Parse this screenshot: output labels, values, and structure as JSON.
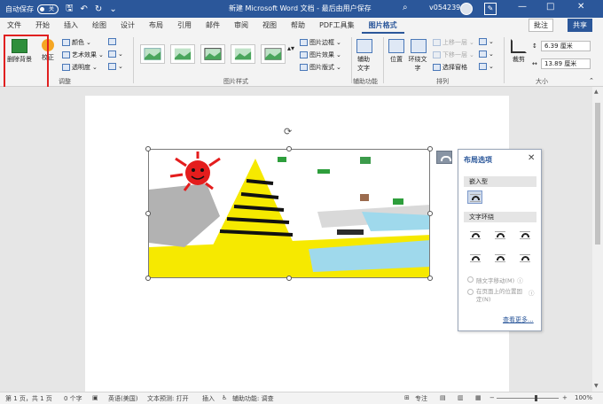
{
  "titlebar": {
    "autosave_label": "自动保存",
    "autosave_state": "关",
    "doc_title": "新建 Microsoft Word 文档  -  最后由用户保存",
    "user_id": "v054239"
  },
  "tabs": [
    "文件",
    "开始",
    "插入",
    "绘图",
    "设计",
    "布局",
    "引用",
    "邮件",
    "审阅",
    "视图",
    "帮助",
    "PDF工具集",
    "图片格式"
  ],
  "active_tab": "图片格式",
  "actions": {
    "comment": "批注",
    "share": "共享"
  },
  "ribbon": {
    "adjust": {
      "remove_bg": "删除背景",
      "correct": "校正",
      "color": "颜色",
      "artistic": "艺术效果",
      "transparency": "透明度",
      "group": "调整"
    },
    "styles": {
      "border": "图片边框",
      "effects": "图片效果",
      "layout": "图片版式",
      "group": "图片样式"
    },
    "accessibility": {
      "alt_text": "辅助文字",
      "group": "辅助功能"
    },
    "arrange": {
      "position": "位置",
      "wrap_text": "环绕文字",
      "bring_forward": "上移一层",
      "send_backward": "下移一层",
      "selection_pane": "选择窗格",
      "group": "排列"
    },
    "size": {
      "crop": "裁剪",
      "height": "6.39 厘米",
      "width": "13.89 厘米",
      "group": "大小"
    }
  },
  "layout_popup": {
    "title": "布局选项",
    "inline_section": "嵌入型",
    "wrap_section": "文字环绕",
    "move_with_text": "随文字移动(M)",
    "fix_position": "在页面上的位置固定(N)",
    "see_more": "查看更多..."
  },
  "statusbar": {
    "page": "第 1 页，共 1 页",
    "words": "0 个字",
    "language": "英语(美国)",
    "prediction": "文本预测: 打开",
    "insert": "插入",
    "accessibility": "辅助功能: 调查",
    "focus": "专注",
    "zoom": "100%"
  },
  "colors": {
    "accent": "#2b579a",
    "highlight": "#e02020"
  }
}
